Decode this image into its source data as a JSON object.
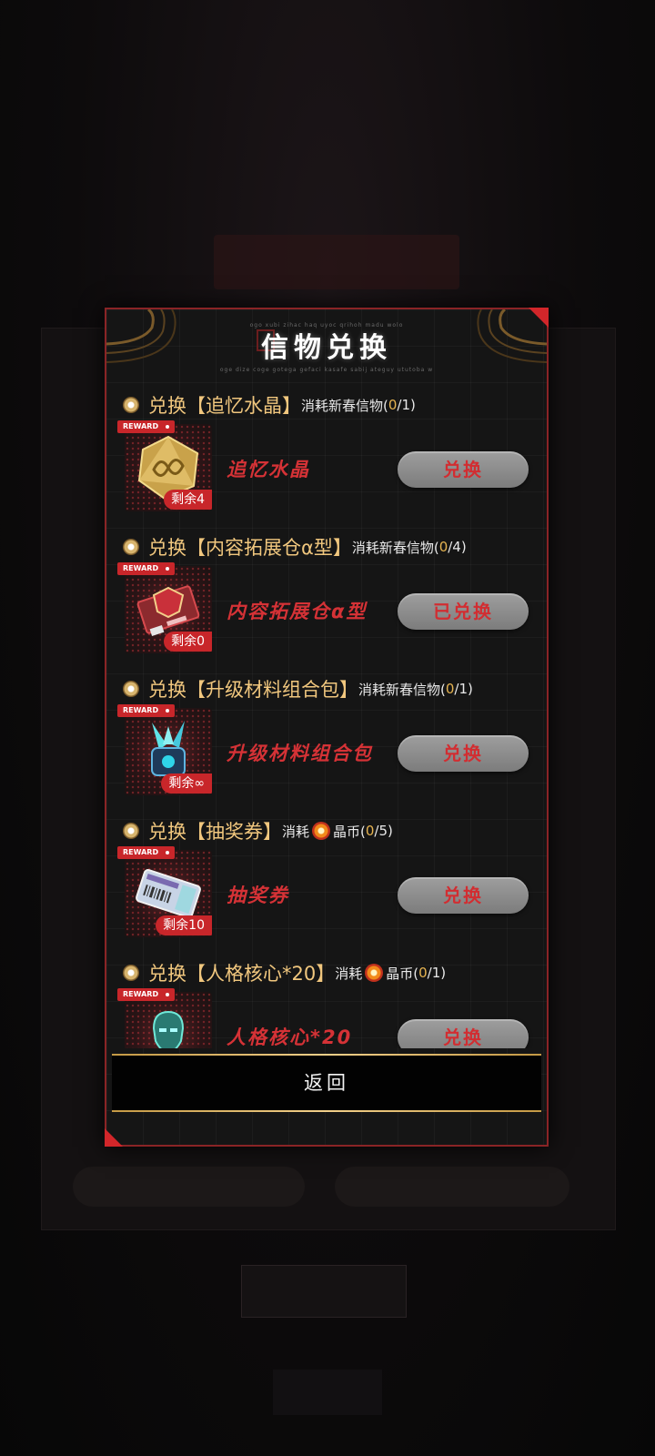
{
  "dialog": {
    "title": "信物兑换",
    "subtitle_top": "ogo xubi zihac haq uyoc qrihoh madu wolo",
    "subtitle_bottom": "oge dize coge gotega gefaci kasafe sabij ateguy ututoba w"
  },
  "items": [
    {
      "prefix": "兑换",
      "name_bracket": "【追忆水晶】",
      "cost_text": "消耗新春信物(",
      "cost_icon": "",
      "cost_currency": "",
      "count": "0",
      "count_rest": "/1)",
      "tag": "REWARD",
      "remain": "剩余4",
      "display_name": "追忆水晶",
      "button": "兑换",
      "icon": "crystal-icon"
    },
    {
      "prefix": "兑换",
      "name_bracket": "【内容拓展仓α型】",
      "cost_text": "消耗新春信物(",
      "cost_icon": "",
      "cost_currency": "",
      "count": "0",
      "count_rest": "/4)",
      "tag": "REWARD",
      "remain": "剩余0",
      "display_name": "内容拓展仓α型",
      "button": "已兑换",
      "icon": "expansion-chip-icon"
    },
    {
      "prefix": "兑换",
      "name_bracket": "【升级材料组合包】",
      "cost_text": "消耗新春信物(",
      "cost_icon": "",
      "cost_currency": "",
      "count": "0",
      "count_rest": "/1)",
      "tag": "REWARD",
      "remain": "剩余∞",
      "display_name": "升级材料组合包",
      "button": "兑换",
      "icon": "material-pack-icon"
    },
    {
      "prefix": "兑换",
      "name_bracket": "【抽奖券】",
      "cost_text": "消耗",
      "cost_icon": "coin-icon",
      "cost_currency": "晶币(",
      "count": "0",
      "count_rest": "/5)",
      "tag": "REWARD",
      "remain": "剩余10",
      "display_name": "抽奖券",
      "button": "兑换",
      "icon": "lottery-ticket-icon"
    },
    {
      "prefix": "兑换",
      "name_bracket": "【人格核心*20】",
      "cost_text": "消耗",
      "cost_icon": "coin-icon",
      "cost_currency": "晶币(",
      "count": "0",
      "count_rest": "/1)",
      "tag": "REWARD",
      "remain": "",
      "display_name": "人格核心*20",
      "button": "兑换",
      "icon": "persona-core-icon"
    }
  ],
  "back_button": "返回",
  "colors": {
    "accent_red": "#d53236",
    "gold": "#f1c77e",
    "frame": "#8a2426"
  }
}
